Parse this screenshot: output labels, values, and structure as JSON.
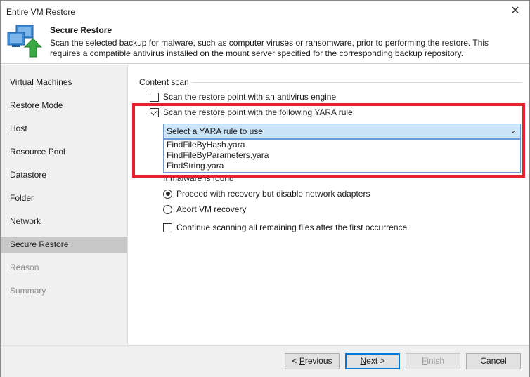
{
  "window": {
    "title": "Entire VM Restore",
    "close_glyph": "✕"
  },
  "header": {
    "title": "Secure Restore",
    "description": "Scan the selected backup for malware, such as computer viruses or ransomware, prior to performing the restore. This requires a compatible antivirus installed on the mount server specified for the corresponding backup repository.",
    "icon": "vm-restore-icon"
  },
  "sidebar": {
    "items": [
      {
        "label": "Virtual Machines",
        "state": "normal"
      },
      {
        "label": "Restore Mode",
        "state": "normal"
      },
      {
        "label": "Host",
        "state": "normal"
      },
      {
        "label": "Resource Pool",
        "state": "normal"
      },
      {
        "label": "Datastore",
        "state": "normal"
      },
      {
        "label": "Folder",
        "state": "normal"
      },
      {
        "label": "Network",
        "state": "normal"
      },
      {
        "label": "Secure Restore",
        "state": "active"
      },
      {
        "label": "Reason",
        "state": "disabled"
      },
      {
        "label": "Summary",
        "state": "disabled"
      }
    ]
  },
  "content": {
    "group_label": "Content scan",
    "antivirus_label": "Scan the restore point with an antivirus engine",
    "antivirus_checked": false,
    "yara_label": "Scan the restore point with the following YARA rule:",
    "yara_checked": true,
    "yara_select": {
      "placeholder": "Select a YARA rule to use",
      "options": [
        "FindFileByHash.yara",
        "FindFileByParameters.yara",
        "FindString.yara"
      ]
    },
    "malware_label": "If malware is found",
    "proceed_label": "Proceed with recovery but disable network adapters",
    "proceed_selected": true,
    "abort_label": "Abort VM recovery",
    "abort_selected": false,
    "continue_label": "Continue scanning all remaining files after the first occurrence",
    "continue_checked": false
  },
  "footer": {
    "previous_prefix": "< ",
    "previous_key": "P",
    "previous_rest": "revious",
    "next_key": "N",
    "next_rest": "ext >",
    "finish_key": "F",
    "finish_rest": "inish",
    "cancel_label": "Cancel"
  },
  "colors": {
    "highlight": "#e8202a",
    "accent": "#0078d7",
    "dropdown_bg": "#cce4f7"
  }
}
